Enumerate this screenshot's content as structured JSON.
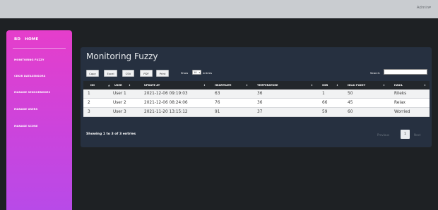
{
  "topbar": {
    "user_menu": "Admin▾"
  },
  "sidebar": {
    "brand_short": "BD",
    "brand_home": "HOME",
    "items": [
      {
        "label": "MONITORING FUZZY"
      },
      {
        "label": "CEKIR DATASENSORS"
      },
      {
        "label": "MANAGE SENSORNODES"
      },
      {
        "label": "MANAGE USERS"
      },
      {
        "label": "MANAGE SCORE"
      }
    ]
  },
  "main": {
    "title": "Monitoring Fuzzy",
    "buttons": {
      "copy": "Copy",
      "excel": "Excel",
      "csv": "CSV",
      "pdf": "PDF",
      "print": "Print"
    },
    "length": {
      "show": "Show",
      "value": "10",
      "entries": "entries"
    },
    "search": {
      "label": "Search:",
      "value": ""
    },
    "table": {
      "headers": [
        "NO",
        "USER",
        "UPDATE AT",
        "HEARTRATE",
        "TEMPERATURE",
        "GSR",
        "NILAI FUZZY",
        "HASIL"
      ],
      "rows": [
        [
          "1",
          "User 1",
          "2021-12-06 09:19:03",
          "63",
          "36",
          "1",
          "50",
          "Rileks"
        ],
        [
          "2",
          "User 2",
          "2021-12-06 08:24:06",
          "76",
          "36",
          "66",
          "45",
          "Relax"
        ],
        [
          "3",
          "User 3",
          "2021-11-20 13:15:12",
          "91",
          "37",
          "59",
          "60",
          "Worried"
        ]
      ]
    },
    "info": "Showing 1 to 3 of 3 entries",
    "pagination": {
      "previous": "Previous",
      "current": "1",
      "next": "Next"
    }
  }
}
